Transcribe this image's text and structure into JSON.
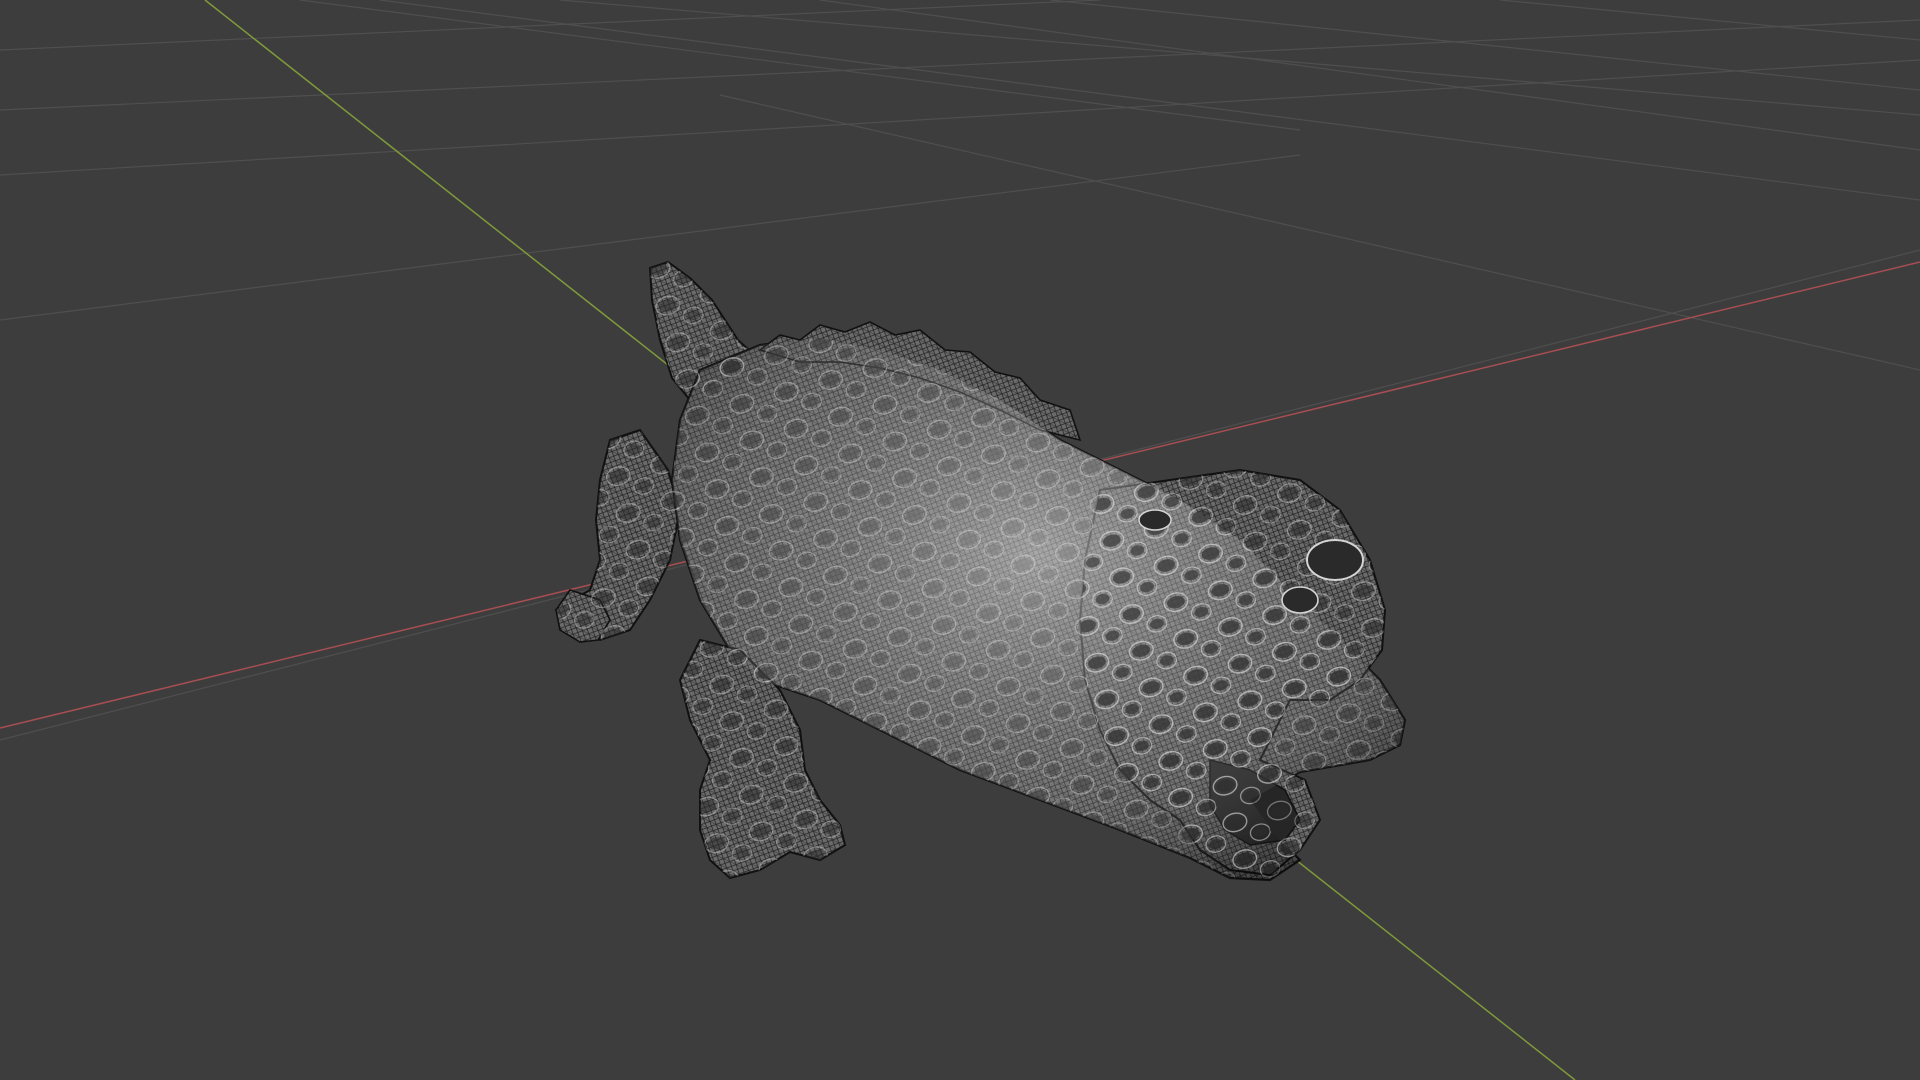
{
  "viewport": {
    "background": "#3d3d3d",
    "grid_color": "#4f4f4f",
    "x_axis_color": "#a84e52",
    "y_axis_color": "#7f9a3a"
  },
  "model": {
    "subject": "crocodile",
    "display": "wireframe",
    "fill_color": "#6a6a6a",
    "wire_color": "#1c1c1c",
    "highlight_color": "#cfcfcf"
  }
}
